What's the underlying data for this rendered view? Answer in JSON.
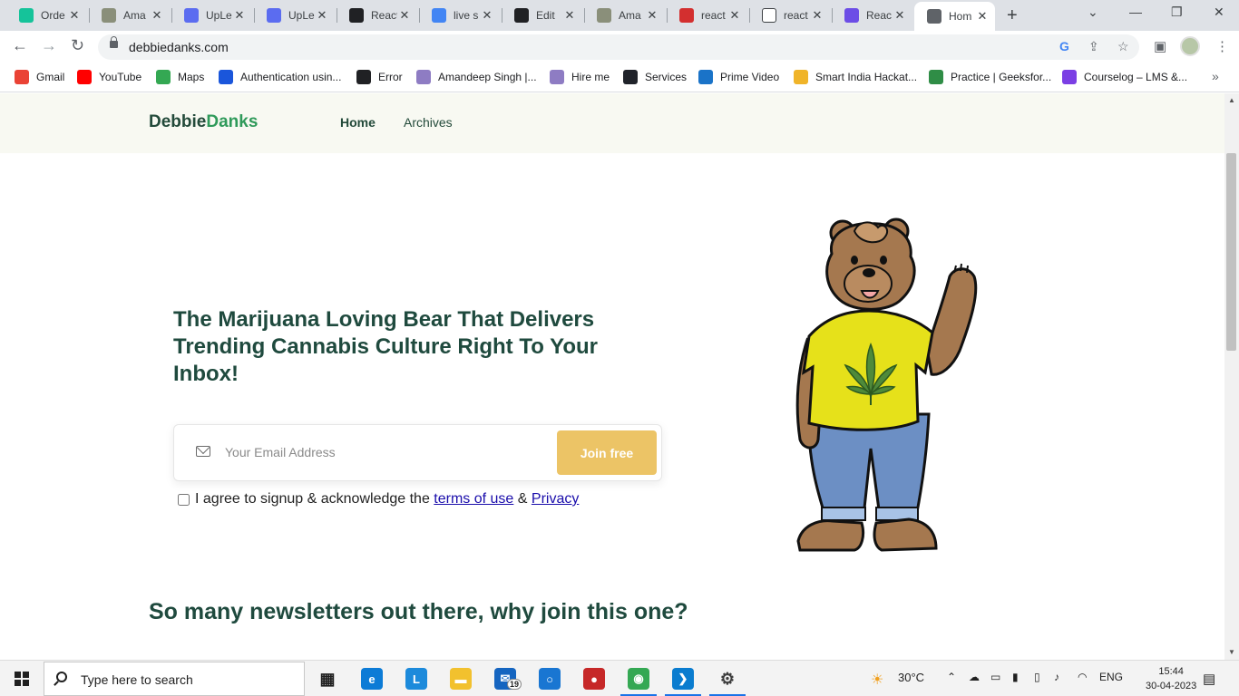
{
  "browser": {
    "tabs": [
      {
        "label": "Orde",
        "icon": "grammarly-icon",
        "color": "#15c39a"
      },
      {
        "label": "Ama",
        "icon": "avatar-icon",
        "color": "#8a8f7a"
      },
      {
        "label": "UpLe",
        "icon": "uplers-icon",
        "color": "#5b6cf0"
      },
      {
        "label": "UpLe",
        "icon": "uplers-icon",
        "color": "#5b6cf0"
      },
      {
        "label": "React",
        "icon": "codepen-icon",
        "color": "#202124"
      },
      {
        "label": "live s",
        "icon": "google-icon",
        "color": "#4285f4"
      },
      {
        "label": "Edit",
        "icon": "github-icon",
        "color": "#202124"
      },
      {
        "label": "Ama",
        "icon": "avatar-icon",
        "color": "#8a8f7a"
      },
      {
        "label": "react",
        "icon": "red-square-icon",
        "color": "#d32f2f"
      },
      {
        "label": "react",
        "icon": "blank-page-icon",
        "color": "#ffffff"
      },
      {
        "label": "Reac",
        "icon": "mr-icon",
        "color": "#6c4de6"
      },
      {
        "label": "Hom",
        "icon": "globe-icon",
        "color": "#5f6368",
        "active": true
      }
    ],
    "url": "debbiedanks.com",
    "bookmarks": [
      {
        "label": "Gmail",
        "icon": "gmail-icon",
        "color": "#ea4335"
      },
      {
        "label": "YouTube",
        "icon": "youtube-icon",
        "color": "#ff0000"
      },
      {
        "label": "Maps",
        "icon": "maps-icon",
        "color": "#34a853"
      },
      {
        "label": "Authentication usin...",
        "icon": "infinity-icon",
        "color": "#1a56db"
      },
      {
        "label": "Error",
        "icon": "codepen-icon",
        "color": "#202124"
      },
      {
        "label": "Amandeep Singh |...",
        "icon": "spiral-icon",
        "color": "#8e7cc3"
      },
      {
        "label": "Hire me",
        "icon": "spiral-icon",
        "color": "#8e7cc3"
      },
      {
        "label": "Services",
        "icon": "react-icon",
        "color": "#20232a"
      },
      {
        "label": "Prime Video",
        "icon": "play-icon",
        "color": "#1a73c8"
      },
      {
        "label": "Smart India Hackat...",
        "icon": "bulb-icon",
        "color": "#f0b429"
      },
      {
        "label": "Practice | Geeksfor...",
        "icon": "gfg-icon",
        "color": "#2f8d46"
      },
      {
        "label": "Courselog – LMS &...",
        "icon": "check-icon",
        "color": "#7b3fe4"
      }
    ]
  },
  "site": {
    "logo_part1": "Debbie",
    "logo_part2": "Danks",
    "nav": [
      "Home",
      "Archives"
    ],
    "hero_title": "The Marijuana Loving Bear That Delivers Trending Cannabis Culture Right To Your Inbox!",
    "email_placeholder": "Your Email Address",
    "join_label": "Join free",
    "consent_text": "I agree to signup & acknowledge the",
    "terms_link": "terms of use",
    "amp": "&",
    "privacy_link": "Privacy",
    "section_title": "So many newsletters out there, why join this one?",
    "colors": {
      "brand_dark": "#1f4a3e",
      "brand_green": "#2f9a5a",
      "button": "#ecc466",
      "header_bg": "#f8f9f2"
    }
  },
  "taskbar": {
    "search_placeholder": "Type here to search",
    "apps": [
      {
        "name": "task-view-icon",
        "glyph": "▦",
        "color": "#1f1f1f"
      },
      {
        "name": "edge-icon",
        "glyph": "e",
        "color": "#0c7bd6"
      },
      {
        "name": "l-app-icon",
        "glyph": "L",
        "color": "#1c8adb"
      },
      {
        "name": "file-explorer-icon",
        "glyph": "▬",
        "color": "#f2c12e"
      },
      {
        "name": "mail-icon",
        "glyph": "✉",
        "color": "#1565c0",
        "badge": "19"
      },
      {
        "name": "cortana-icon",
        "glyph": "○",
        "color": "#1976d2"
      },
      {
        "name": "cricket-icon",
        "glyph": "●",
        "color": "#c62828"
      },
      {
        "name": "chrome-icon",
        "glyph": "◉",
        "color": "#34a853",
        "running": true
      },
      {
        "name": "vscode-icon",
        "glyph": "❯",
        "color": "#0a7ccf",
        "running": true
      },
      {
        "name": "settings-icon",
        "glyph": "⚙",
        "color": "#3c3c3c",
        "running": true
      }
    ],
    "weather": "30°C",
    "language": "ENG",
    "time": "15:44",
    "date": "30-04-2023"
  }
}
